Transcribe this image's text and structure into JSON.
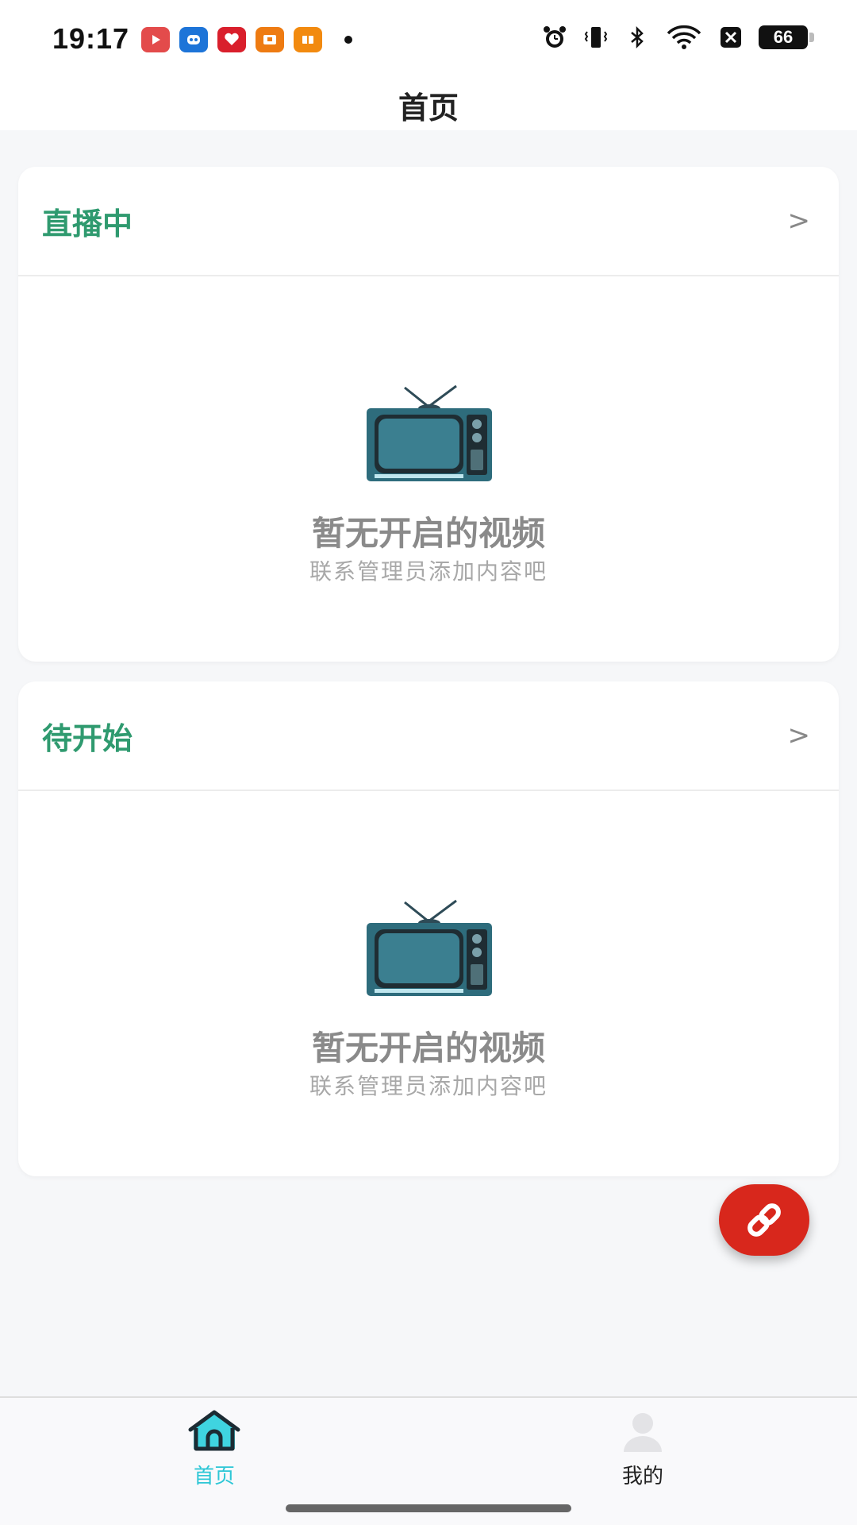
{
  "status_bar": {
    "time": "19:17",
    "battery": "66",
    "app_icons": [
      "video-app-icon",
      "robot-app-icon",
      "heart-app-icon",
      "wallet-app-icon",
      "book-app-icon"
    ],
    "system_icons": [
      "alarm-icon",
      "vibrate-icon",
      "bluetooth-icon",
      "wifi-icon",
      "sim-off-icon"
    ]
  },
  "header": {
    "title": "首页"
  },
  "sections": [
    {
      "title": "直播中",
      "arrow": ">",
      "empty_title": "暂无开启的视频",
      "empty_subtitle": "联系管理员添加内容吧"
    },
    {
      "title": "待开始",
      "arrow": ">",
      "empty_title": "暂无开启的视频",
      "empty_subtitle": "联系管理员添加内容吧"
    }
  ],
  "fab": {
    "icon": "link-icon",
    "color": "#d8271c"
  },
  "tabbar": {
    "items": [
      {
        "label": "首页",
        "icon": "home-icon",
        "active": true
      },
      {
        "label": "我的",
        "icon": "user-icon",
        "active": false
      }
    ]
  },
  "colors": {
    "accent": "#2f9a6f",
    "tab_active": "#2ec7d6"
  }
}
